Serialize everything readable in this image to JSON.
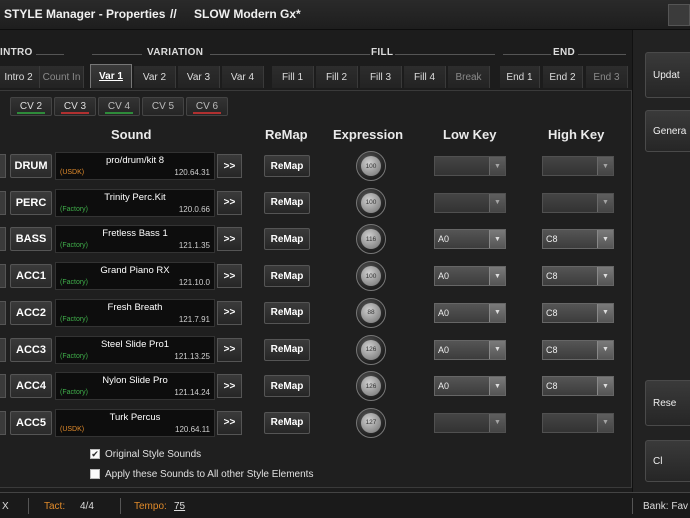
{
  "window": {
    "title_app": "STYLE Manager - Properties",
    "title_sep": "//",
    "title_style": "SLOW Modern Gx*"
  },
  "sections": {
    "intro": "INTRO",
    "variation": "VARIATION",
    "fill": "FILL",
    "end": "END"
  },
  "tabs": [
    {
      "label": "Intro 2",
      "state": "normal"
    },
    {
      "label": "Count In",
      "state": "dim"
    },
    {
      "label": "Var 1",
      "state": "active"
    },
    {
      "label": "Var 2",
      "state": "normal"
    },
    {
      "label": "Var 3",
      "state": "normal"
    },
    {
      "label": "Var 4",
      "state": "normal"
    },
    {
      "label": "Fill 1",
      "state": "normal"
    },
    {
      "label": "Fill 2",
      "state": "normal"
    },
    {
      "label": "Fill 3",
      "state": "normal"
    },
    {
      "label": "Fill 4",
      "state": "normal"
    },
    {
      "label": "Break",
      "state": "dim"
    },
    {
      "label": "End 1",
      "state": "normal"
    },
    {
      "label": "End 2",
      "state": "normal"
    },
    {
      "label": "End 3",
      "state": "dim"
    }
  ],
  "cv_tabs": [
    {
      "label": "CV 2",
      "bar": "#2e8b3a"
    },
    {
      "label": "CV 3",
      "bar": "#b03030"
    },
    {
      "label": "CV 4",
      "bar": "#2e8b3a",
      "dim": true
    },
    {
      "label": "CV 5",
      "bar": "",
      "dim": true
    },
    {
      "label": "CV 6",
      "bar": "#b03030",
      "dim": true
    }
  ],
  "headers": {
    "sound": "Sound",
    "remap": "ReMap",
    "expression": "Expression",
    "low_key": "Low Key",
    "high_key": "High Key"
  },
  "rows": [
    {
      "name": "DRUM",
      "sound": "pro/drum/kit 8",
      "tag": "(USDK)",
      "tag_color": "#e08a2a",
      "number": "120.64.31",
      "expression": "100",
      "low": "",
      "high": ""
    },
    {
      "name": "PERC",
      "sound": "Trinity Perc.Kit",
      "tag": "(Factory)",
      "tag_color": "#3fae4a",
      "number": "120.0.66",
      "expression": "100",
      "low": "",
      "high": ""
    },
    {
      "name": "BASS",
      "sound": "Fretless Bass 1",
      "tag": "(Factory)",
      "tag_color": "#3fae4a",
      "number": "121.1.35",
      "expression": "116",
      "low": "A0",
      "high": "C8"
    },
    {
      "name": "ACC1",
      "sound": "Grand Piano RX",
      "tag": "(Factory)",
      "tag_color": "#3fae4a",
      "number": "121.10.0",
      "expression": "100",
      "low": "A0",
      "high": "C8"
    },
    {
      "name": "ACC2",
      "sound": "Fresh Breath",
      "tag": "(Factory)",
      "tag_color": "#3fae4a",
      "number": "121.7.91",
      "expression": "88",
      "low": "A0",
      "high": "C8"
    },
    {
      "name": "ACC3",
      "sound": "Steel Slide Pro1",
      "tag": "(Factory)",
      "tag_color": "#3fae4a",
      "number": "121.13.25",
      "expression": "126",
      "low": "A0",
      "high": "C8"
    },
    {
      "name": "ACC4",
      "sound": "Nylon Slide Pro",
      "tag": "(Factory)",
      "tag_color": "#3fae4a",
      "number": "121.14.24",
      "expression": "126",
      "low": "A0",
      "high": "C8"
    },
    {
      "name": "ACC5",
      "sound": "Turk Percus",
      "tag": "(USDK)",
      "tag_color": "#e08a2a",
      "number": "120.64.11",
      "expression": "127",
      "low": "",
      "high": ""
    }
  ],
  "buttons": {
    "arrow": ">>",
    "remap": "ReMap",
    "dd_arrow": "▼"
  },
  "options": [
    {
      "label": "Original Style Sounds",
      "checked": true
    },
    {
      "label": "Apply these Sounds to All other Style Elements",
      "checked": false
    }
  ],
  "side_buttons": {
    "update": "Updat",
    "generate": "Genera",
    "reset": "Rese",
    "close": "Cl"
  },
  "status": {
    "left": "X",
    "tact_label": "Tact:",
    "tact_value": "4/4",
    "tempo_label": "Tempo:",
    "tempo_value": "75",
    "bank": "Bank: Fav"
  }
}
